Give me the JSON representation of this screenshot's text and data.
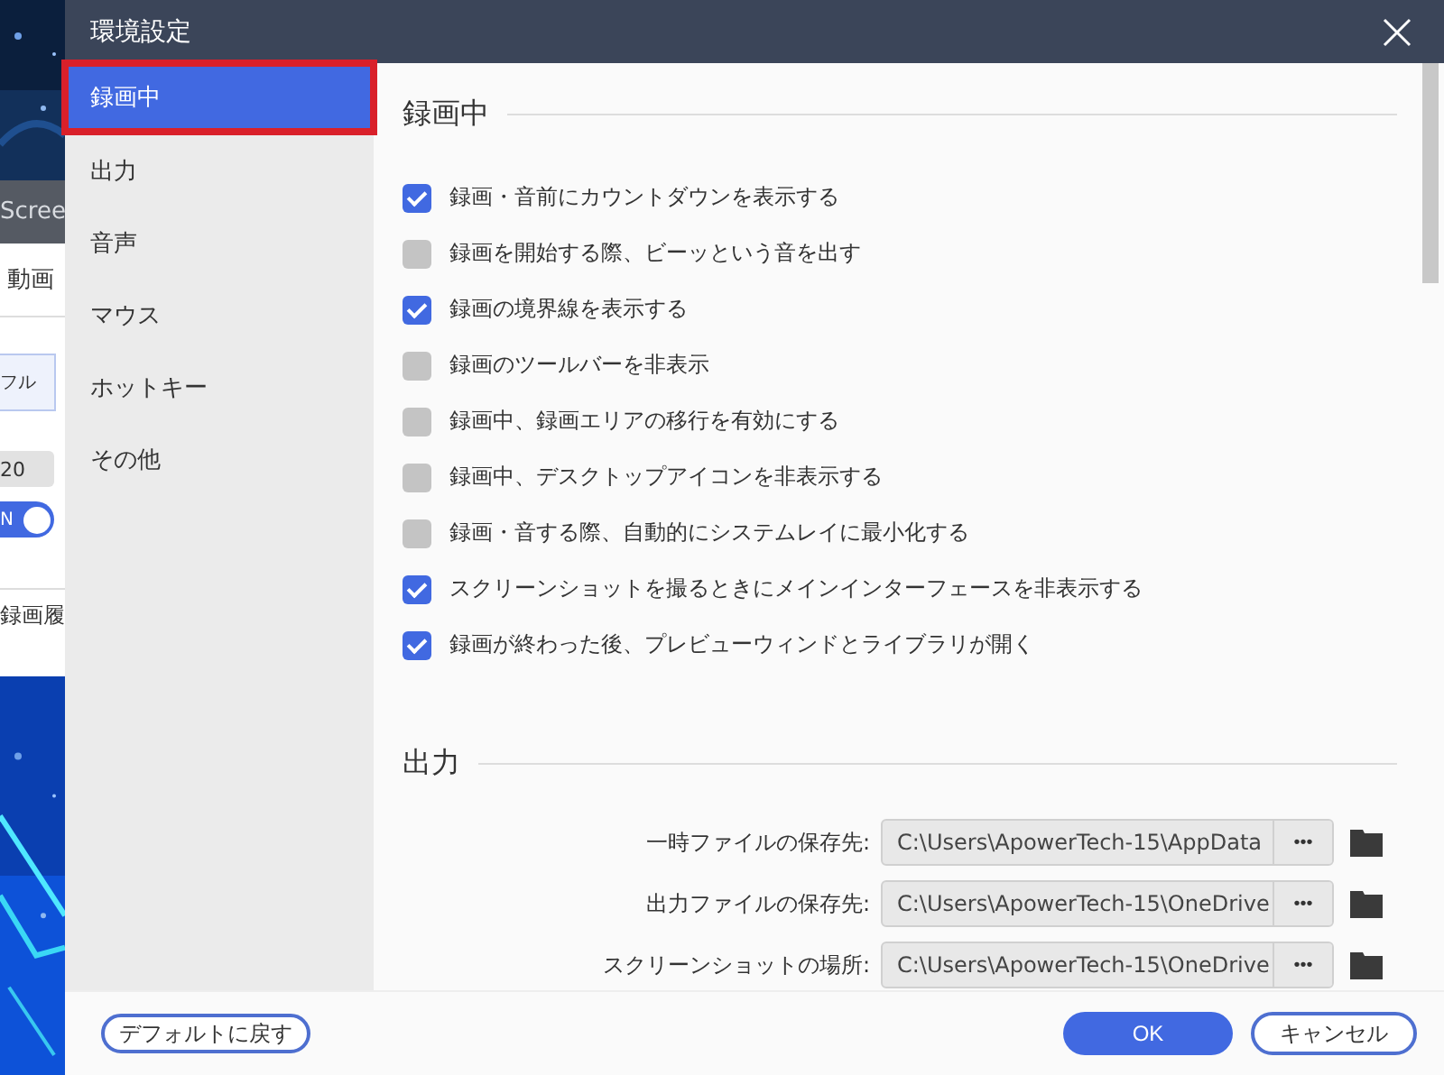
{
  "background_app": {
    "title": "Scree",
    "tab": "動画",
    "mode": "フル",
    "value": "20",
    "toggle": {
      "label": "N",
      "on": true
    },
    "history": "録画履"
  },
  "window": {
    "title": "環境設定"
  },
  "sidebar": {
    "items": [
      {
        "label": "録画中",
        "selected": true
      },
      {
        "label": "出力",
        "selected": false
      },
      {
        "label": "音声",
        "selected": false
      },
      {
        "label": "マウス",
        "selected": false
      },
      {
        "label": "ホットキー",
        "selected": false
      },
      {
        "label": "その他",
        "selected": false
      }
    ]
  },
  "sections": [
    {
      "title": "録画中",
      "kind": "checkboxes",
      "options": [
        {
          "label": "録画・音前にカウントダウンを表示する",
          "checked": true
        },
        {
          "label": "録画を開始する際、ビーッという音を出す",
          "checked": false
        },
        {
          "label": "録画の境界線を表示する",
          "checked": true
        },
        {
          "label": "録画のツールバーを非表示",
          "checked": false
        },
        {
          "label": "録画中、録画エリアの移行を有効にする",
          "checked": false
        },
        {
          "label": "録画中、デスクトップアイコンを非表示する",
          "checked": false
        },
        {
          "label": "録画・音する際、自動的にシステムレイに最小化する",
          "checked": false
        },
        {
          "label": "スクリーンショットを撮るときにメインインターフェースを非表示する",
          "checked": true
        },
        {
          "label": "録画が終わった後、プレビューウィンドとライブラリが開く",
          "checked": true
        }
      ]
    },
    {
      "title": "出力",
      "kind": "paths",
      "paths": [
        {
          "label": "一時ファイルの保存先:",
          "value": "C:\\Users\\ApowerTech-15\\AppData",
          "button": "•••"
        },
        {
          "label": "出力ファイルの保存先:",
          "value": "C:\\Users\\ApowerTech-15\\OneDrive",
          "button": "•••"
        },
        {
          "label": "スクリーンショットの場所:",
          "value": "C:\\Users\\ApowerTech-15\\OneDrive",
          "button": "•••"
        }
      ]
    }
  ],
  "footer": {
    "reset": "デフォルトに戻す",
    "ok": "OK",
    "cancel": "キャンセル"
  }
}
